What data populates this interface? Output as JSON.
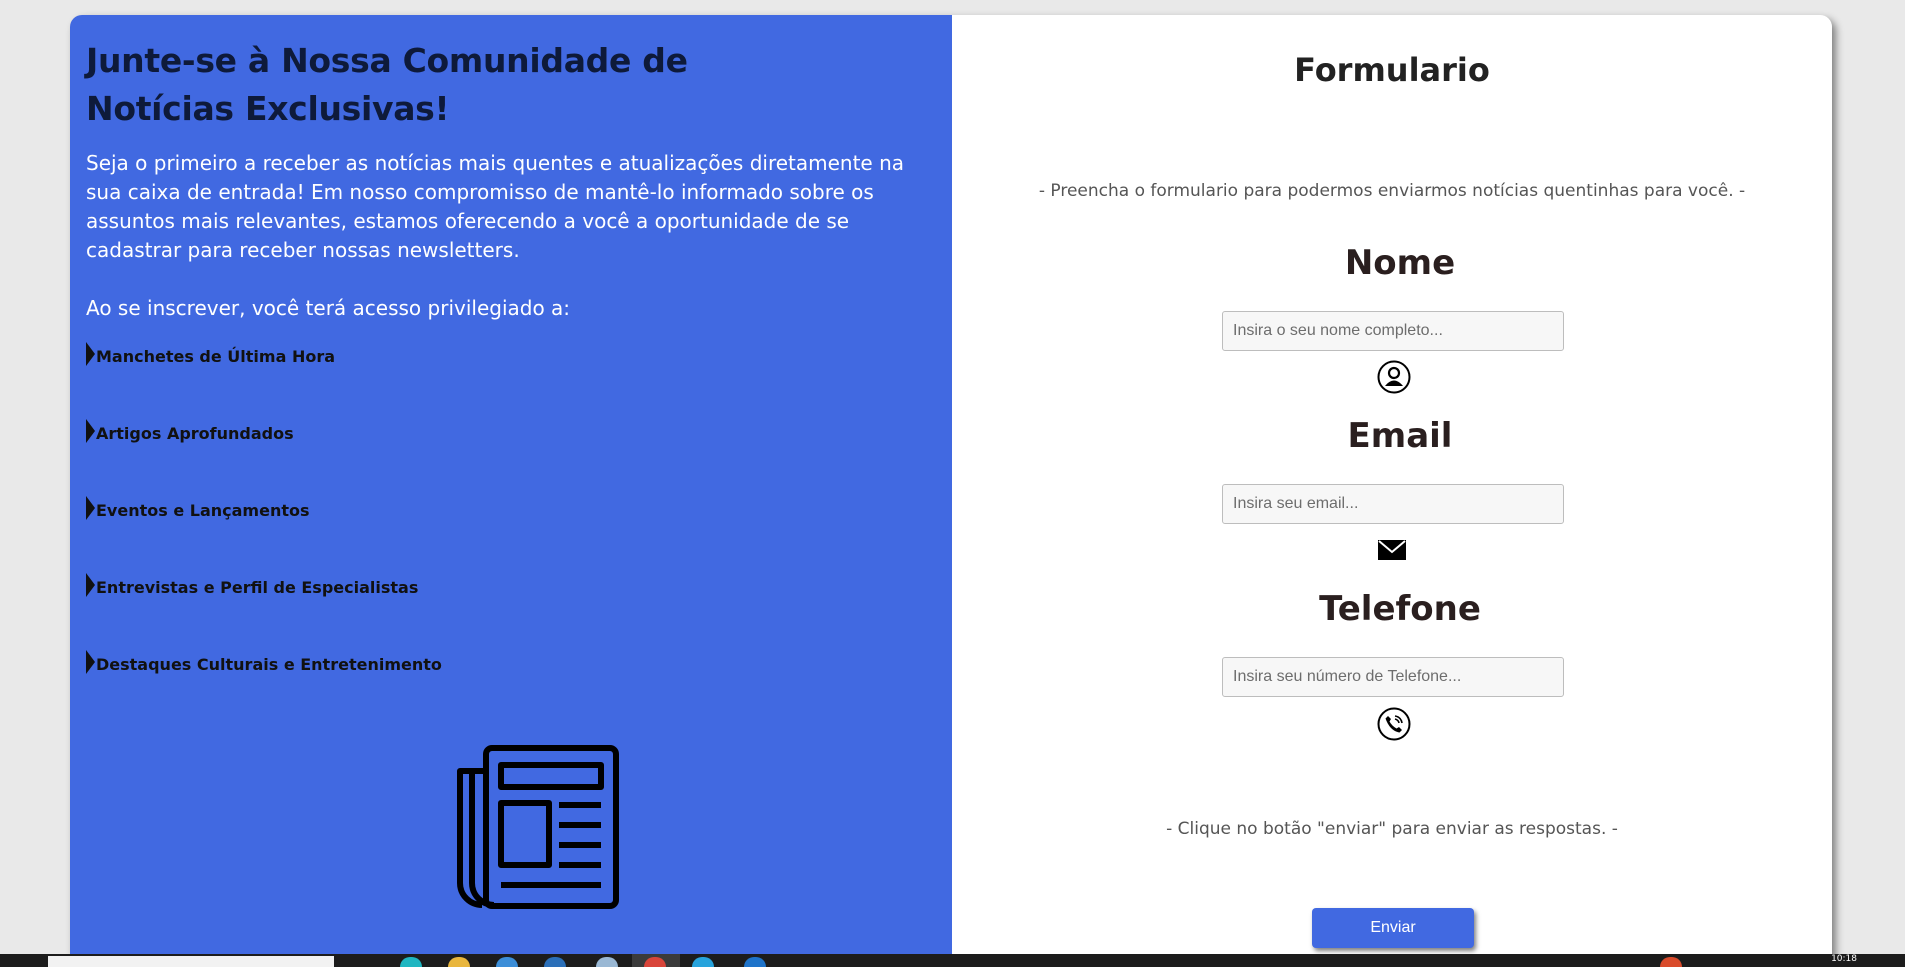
{
  "left": {
    "heading": "Junte-se à Nossa Comunidade de Notícias Exclusivas!",
    "intro": "Seja o primeiro a receber as notícias mais quentes e atualizações diretamente na sua caixa de entrada! Em nosso compromisso de mantê-lo informado sobre os assuntos mais relevantes, estamos oferecendo a você a oportunidade de se cadastrar para receber nossas newsletters.",
    "intro2": "Ao se inscrever, você terá acesso privilegiado a:",
    "features": [
      "Manchetes de Última Hora",
      "Artigos Aprofundados",
      "Eventos e Lançamentos",
      "Entrevistas e Perfil de Especialistas",
      "Destaques Culturais e Entretenimento"
    ],
    "illustration_icon": "newspaper-icon"
  },
  "form": {
    "title": "Formulario",
    "subtitle": "- Preencha o formulario para podermos enviarmos notícias quentinhas para você. -",
    "name_label": "Nome",
    "name_placeholder": "Insira o seu nome completo...",
    "name_icon": "user-icon",
    "email_label": "Email",
    "email_placeholder": "Insira seu email...",
    "email_icon": "envelope-icon",
    "phone_label": "Telefone",
    "phone_placeholder": "Insira seu número de Telefone...",
    "phone_icon": "phone-icon",
    "note": "- Clique no botão \"enviar\" para enviar as respostas. -",
    "submit_label": "Enviar"
  },
  "colors": {
    "accent": "#4169e1",
    "heading_dark": "#0e1a3a"
  },
  "taskbar": {
    "clock": "10:18"
  }
}
